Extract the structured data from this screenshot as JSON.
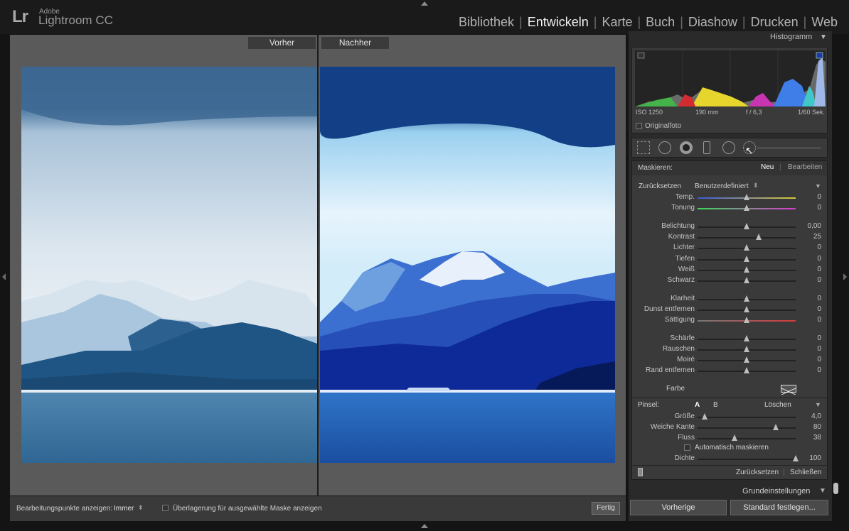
{
  "app": {
    "logo": "Lr",
    "brand_line1": "Adobe",
    "brand_line2": "Lightroom CC"
  },
  "modules": [
    {
      "label": "Bibliothek",
      "active": false
    },
    {
      "label": "Entwickeln",
      "active": true
    },
    {
      "label": "Karte",
      "active": false
    },
    {
      "label": "Buch",
      "active": false
    },
    {
      "label": "Diashow",
      "active": false
    },
    {
      "label": "Drucken",
      "active": false
    },
    {
      "label": "Web",
      "active": false
    }
  ],
  "view": {
    "before_label": "Vorher",
    "after_label": "Nachher"
  },
  "toolbar": {
    "edit_points_label": "Bearbeitungspunkte anzeigen:",
    "edit_points_value": "Immer",
    "overlay_label": "Überlagerung für ausgewählte Maske anzeigen",
    "done_button": "Fertig"
  },
  "histogram": {
    "title": "Histogramm",
    "iso": "ISO 1250",
    "focal": "190 mm",
    "aperture": "f / 6,3",
    "shutter": "1/60 Sek.",
    "original_label": "Originalfoto"
  },
  "mask": {
    "label": "Maskieren:",
    "new_label": "Neu",
    "edit_label": "Bearbeiten",
    "reset_label": "Zurücksetzen",
    "preset_value": "Benutzerdefiniert"
  },
  "adjustments": [
    {
      "label": "Temp.",
      "value": "0",
      "pos": 0.5
    },
    {
      "label": "Tonung",
      "value": "0",
      "pos": 0.5
    },
    {
      "label": "Belichtung",
      "value": "0,00",
      "pos": 0.5
    },
    {
      "label": "Kontrast",
      "value": "25",
      "pos": 0.62
    },
    {
      "label": "Lichter",
      "value": "0",
      "pos": 0.5
    },
    {
      "label": "Tiefen",
      "value": "0",
      "pos": 0.5
    },
    {
      "label": "Weiß",
      "value": "0",
      "pos": 0.5
    },
    {
      "label": "Schwarz",
      "value": "0",
      "pos": 0.5
    },
    {
      "label": "Klarheit",
      "value": "0",
      "pos": 0.5
    },
    {
      "label": "Dunst entfernen",
      "value": "0",
      "pos": 0.5
    },
    {
      "label": "Sättigung",
      "value": "0",
      "pos": 0.5
    },
    {
      "label": "Schärfe",
      "value": "0",
      "pos": 0.5
    },
    {
      "label": "Rauschen",
      "value": "0",
      "pos": 0.5
    },
    {
      "label": "Moiré",
      "value": "0",
      "pos": 0.5
    },
    {
      "label": "Rand entfernen",
      "value": "0",
      "pos": 0.5
    }
  ],
  "color_label": "Farbe",
  "brush": {
    "label": "Pinsel:",
    "a_label": "A",
    "b_label": "B",
    "clear_label": "Löschen",
    "size": {
      "label": "Größe",
      "value": "4,0",
      "pos": 0.07
    },
    "feather": {
      "label": "Weiche Kante",
      "value": "80",
      "pos": 0.8
    },
    "flow": {
      "label": "Fluss",
      "value": "38",
      "pos": 0.38
    },
    "auto_mask_label": "Automatisch maskieren",
    "density": {
      "label": "Dichte",
      "value": "100",
      "pos": 1.0
    }
  },
  "footer": {
    "reset_label": "Zurücksetzen",
    "close_label": "Schließen"
  },
  "basic_label": "Grundeinstellungen",
  "bottom_buttons": {
    "previous": "Vorherige",
    "set_default": "Standard festlegen..."
  }
}
